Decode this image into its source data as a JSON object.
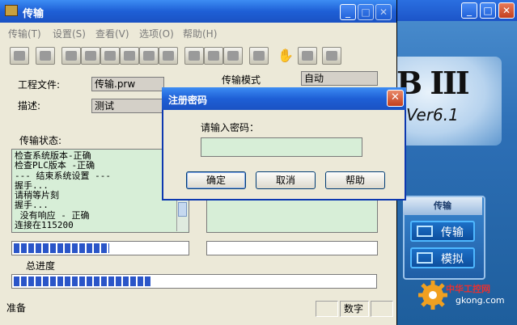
{
  "main_window": {
    "title": "传输",
    "menu": [
      "传输(T)",
      "设置(S)",
      "查看(V)",
      "选项(O)",
      "帮助(H)"
    ],
    "project_file_label": "工程文件:",
    "project_file_value": "传输.prw",
    "description_label": "描述:",
    "description_value": "测试",
    "transfer_mode_label": "传输模式",
    "transfer_mode_value": "自动",
    "transfer_status_label": "传输状态:",
    "status_log": [
      "检查系统版本-正确",
      "检查PLC版本 -正确",
      "--- 结束系统设置 ---",
      "握手...",
      "请稍等片刻",
      "握手...",
      " 没有响应 - 正确",
      "连接在115200"
    ],
    "progress_1_fraction": 0.55,
    "total_progress_label": "总进度",
    "progress_2_fraction": 0.38,
    "status_bar": {
      "left": "准备",
      "right": "数字"
    }
  },
  "dialog": {
    "title": "注册密码",
    "prompt": "请输入密码：",
    "password_value": "",
    "ok_label": "确定",
    "cancel_label": "取消",
    "help_label": "帮助"
  },
  "background_app": {
    "logo_text": "B III",
    "version_text": "Ver6.1",
    "panel_title": "传输",
    "panel_buttons": [
      "传输",
      "模拟"
    ]
  },
  "watermark": {
    "name": "中华工控网",
    "url": "gkong.com"
  },
  "colors": {
    "title_blue": "#1e5fd6",
    "log_bg": "#d7eed7",
    "progress_blue": "#2a55c8",
    "close_red": "#c33f1d"
  }
}
